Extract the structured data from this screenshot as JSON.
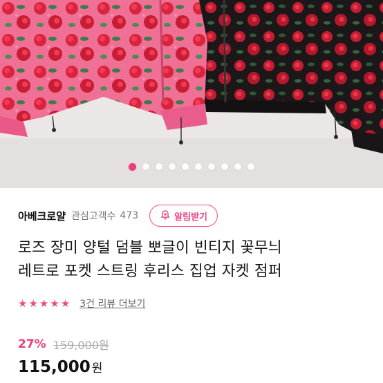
{
  "gallery": {
    "slide_count": 10,
    "active_index": 0,
    "image_alt": "product-photo"
  },
  "seller": {
    "name": "아베크로얄",
    "favorites_label": "관심고객수",
    "favorites_count": "473",
    "notify_label": "알림받기"
  },
  "product": {
    "title_line1": "로즈 장미 양털 덤블 뽀글이 빈티지 꽃무늬",
    "title_line2": "레트로 포켓 스트링 후리스 집업 자켓 점퍼",
    "rating_stars": 5,
    "review_link": "3건 리뷰 더보기",
    "discount": "27%",
    "original_price": "159,000원",
    "price": "115,000",
    "price_unit": "원"
  },
  "colors": {
    "accent": "#ee3d7d",
    "star": "#ea4b7c"
  },
  "icons": {
    "notify": "bell-plus-icon",
    "star": "star-icon"
  }
}
